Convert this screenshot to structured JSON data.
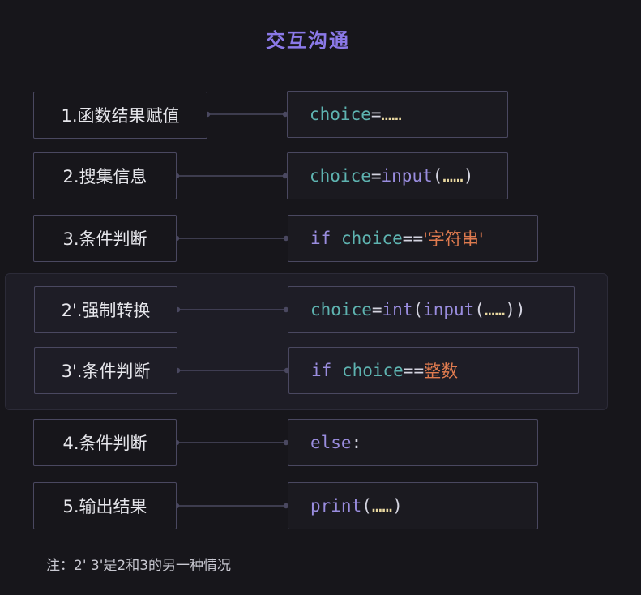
{
  "title": "交互沟通",
  "steps": [
    {
      "label": "1.函数结果赋值"
    },
    {
      "label": "2.搜集信息"
    },
    {
      "label": "3.条件判断"
    },
    {
      "label": "2'.强制转换"
    },
    {
      "label": "3'.条件判断"
    },
    {
      "label": "4.条件判断"
    },
    {
      "label": "5.输出结果"
    }
  ],
  "code": {
    "c1": {
      "var": "choice",
      "op": "=",
      "dots": "……"
    },
    "c2": {
      "var": "choice",
      "op": "=",
      "fn": "input",
      "open": "(",
      "dots": "……",
      "close": ")"
    },
    "c3": {
      "kw": "if ",
      "var": "choice",
      "op": "==",
      "lit": "'字符串'"
    },
    "c4": {
      "var": "choice",
      "op": "=",
      "fn1": "int",
      "open1": "(",
      "fn2": "input",
      "open2": "(",
      "dots": "……",
      "close": "))"
    },
    "c5": {
      "kw": "if ",
      "var": "choice",
      "op": "==",
      "lit": "整数"
    },
    "c6": {
      "kw": "else",
      "colon": ":"
    },
    "c7": {
      "fn": "print",
      "open": "(",
      "dots": "……",
      "close": ")"
    }
  },
  "note": "注：2' 3'是2和3的另一种情况",
  "colors": {
    "title": "#8b79e8",
    "variable": "#5eb3b0",
    "keyword": "#9a8ddf",
    "literal": "#e07b4f",
    "border": "#4a4860",
    "background": "#17161b"
  }
}
